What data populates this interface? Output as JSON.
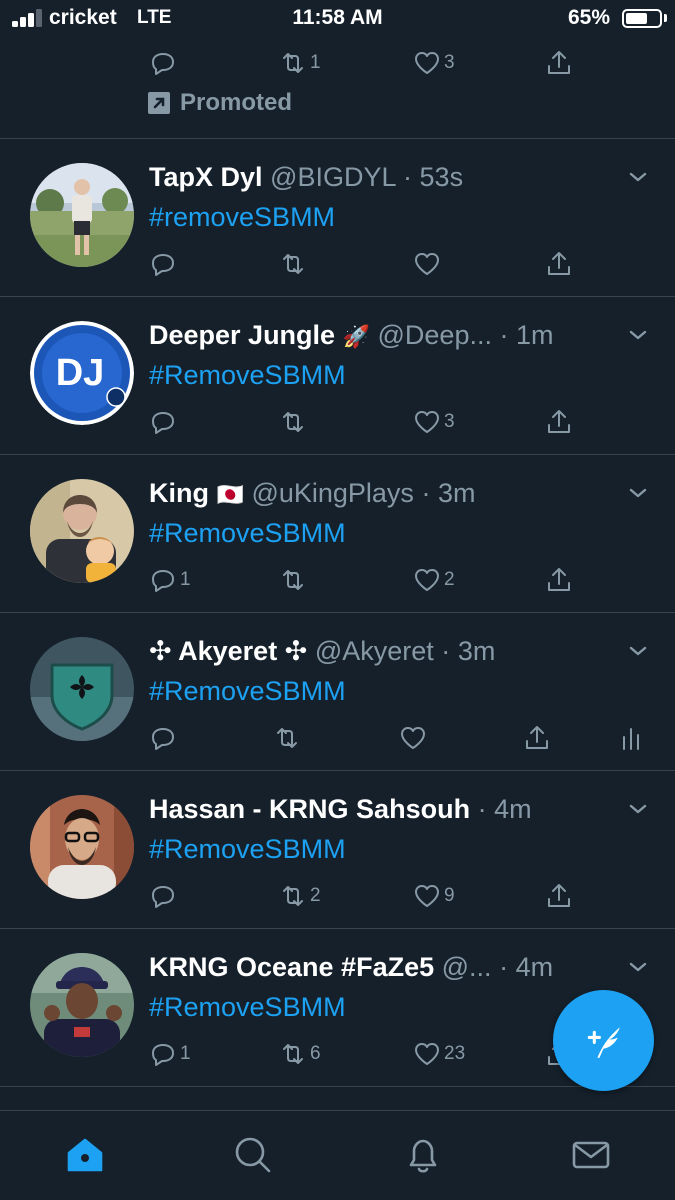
{
  "status_bar": {
    "carrier": "cricket",
    "network": "LTE",
    "time": "11:58 AM",
    "battery_percent": "65%",
    "battery_level": 0.65,
    "signal_bars": 3
  },
  "promoted_tweet": {
    "actions": {
      "replies": "",
      "retweets": "1",
      "likes": "3"
    },
    "promoted_label": "Promoted"
  },
  "tweets": [
    {
      "name": "TapX Dyl",
      "handle": "@BIGDYL",
      "separator": "·",
      "age": "53s",
      "text": "#removeSBMM",
      "replies": "",
      "retweets": "",
      "likes": ""
    },
    {
      "name": "Deeper Jungle",
      "name_emoji": "🚀",
      "handle": "@Deep...",
      "separator": "·",
      "age": "1m",
      "text": "#RemoveSBMM",
      "replies": "",
      "retweets": "",
      "likes": "3",
      "avatar_text": "DJ"
    },
    {
      "name": "King",
      "name_emoji": "🇯🇵",
      "handle": "@uKingPlays",
      "separator": "·",
      "age": "3m",
      "text": "#RemoveSBMM",
      "replies": "1",
      "retweets": "",
      "likes": "2"
    },
    {
      "name": "✣ Akyeret ✣",
      "handle": "@Akyeret",
      "separator": "·",
      "age": "3m",
      "text": "#RemoveSBMM",
      "replies": "",
      "retweets": "",
      "likes": ""
    },
    {
      "name": "Hassan - KRNG Sahsouh",
      "handle": "",
      "separator": "·",
      "age": "4m",
      "text": "#RemoveSBMM",
      "replies": "",
      "retweets": "2",
      "likes": "9"
    },
    {
      "name": "KRNG Oceane #FaZe5",
      "handle": "@...",
      "separator": "·",
      "age": "4m",
      "text": "#RemoveSBMM",
      "replies": "1",
      "retweets": "6",
      "likes": "23"
    }
  ],
  "colors": {
    "background": "#15202b",
    "divider": "#38444d",
    "secondary_text": "#8899a6",
    "accent": "#1da1f2"
  },
  "icons": {
    "reply": "speech-bubble-icon",
    "retweet": "retweet-arrows-icon",
    "like": "heart-icon",
    "share": "share-upload-icon",
    "analytics": "bar-chart-icon",
    "compose": "feather-plus-icon",
    "home": "home-icon",
    "search": "search-icon",
    "notifications": "bell-icon",
    "messages": "envelope-icon"
  }
}
